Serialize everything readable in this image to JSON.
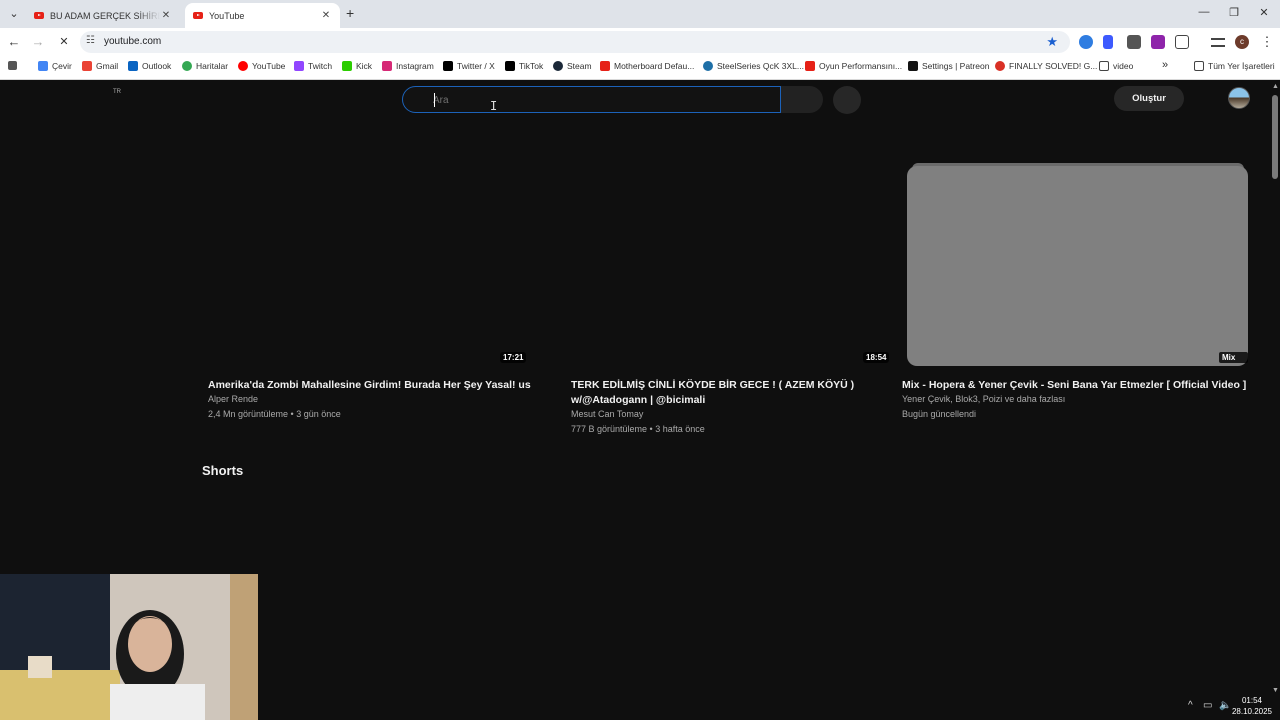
{
  "browser": {
    "tabs": [
      {
        "title": "BU ADAM GERÇEK SİHİRBAZ! A",
        "active": false
      },
      {
        "title": "YouTube",
        "active": true
      }
    ],
    "new_tab": "+",
    "url": "youtube.com",
    "bookmarks": [
      {
        "label": "Çevir",
        "icon_color": "#4285f4"
      },
      {
        "label": "Gmail",
        "icon_color": "#ea4335"
      },
      {
        "label": "Outlook",
        "icon_color": "#0a64c2"
      },
      {
        "label": "Haritalar",
        "icon_color": "#34a853"
      },
      {
        "label": "YouTube",
        "icon_color": "#ff0000"
      },
      {
        "label": "Twitch",
        "icon_color": "#9146ff"
      },
      {
        "label": "Kick",
        "icon_color": "#2ccd00"
      },
      {
        "label": "Instagram",
        "icon_color": "#d62976"
      },
      {
        "label": "Twitter / X",
        "icon_color": "#000000"
      },
      {
        "label": "TikTok",
        "icon_color": "#000000"
      },
      {
        "label": "Steam",
        "icon_color": "#1b2838"
      },
      {
        "label": "Motherboard Defau...",
        "icon_color": "#e62117"
      },
      {
        "label": "SteelSeries QcK 3XL...",
        "icon_color": "#1e6fa7"
      },
      {
        "label": "Oyun Performansını...",
        "icon_color": "#e62117"
      },
      {
        "label": "Settings | Patreon",
        "icon_color": "#141414"
      },
      {
        "label": "FINALLY SOLVED! G...",
        "icon_color": "#d93025"
      },
      {
        "label": "video",
        "icon_color": "#ffffff"
      }
    ],
    "all_bookmarks": "Tüm Yer İşaretleri",
    "more_bookmarks": "»"
  },
  "youtube": {
    "country_code": "TR",
    "search": {
      "placeholder": "Ara",
      "value": ""
    },
    "create_label": "Oluştur",
    "videos": [
      {
        "title": "Amerika'da Zombi Mahallesine Girdim! Burada Her Şey Yasal! us",
        "channel": "Alper Rende",
        "stats": "2,4 Mn görüntüleme • 3 gün önce",
        "duration": "17:21"
      },
      {
        "title": "TERK EDİLMİŞ CİNLİ KÖYDE BİR GECE ! ( AZEM KÖYÜ ) w/@Atadogann | @bicimali",
        "channel": "Mesut Can Tomay",
        "stats": "777 B görüntüleme • 3 hafta önce",
        "duration": "18:54"
      },
      {
        "title": "Mix - Hopera & Yener Çevik - Seni Bana Yar Etmezler [ Official Video ]",
        "channel": "Yener Çevik, Blok3, Poizi ve daha fazlası",
        "stats": "Bugün güncellendi",
        "duration": "Mix"
      }
    ],
    "shorts_heading": "Shorts"
  },
  "taskbar": {
    "time": "01:54",
    "date": "28.10.2025"
  },
  "colors": {
    "yt_background": "#0f0f0f",
    "search_focus_border": "#1c62b9",
    "mix_thumbnail": "#808080",
    "bookmark_star": "#1a5fd0"
  }
}
